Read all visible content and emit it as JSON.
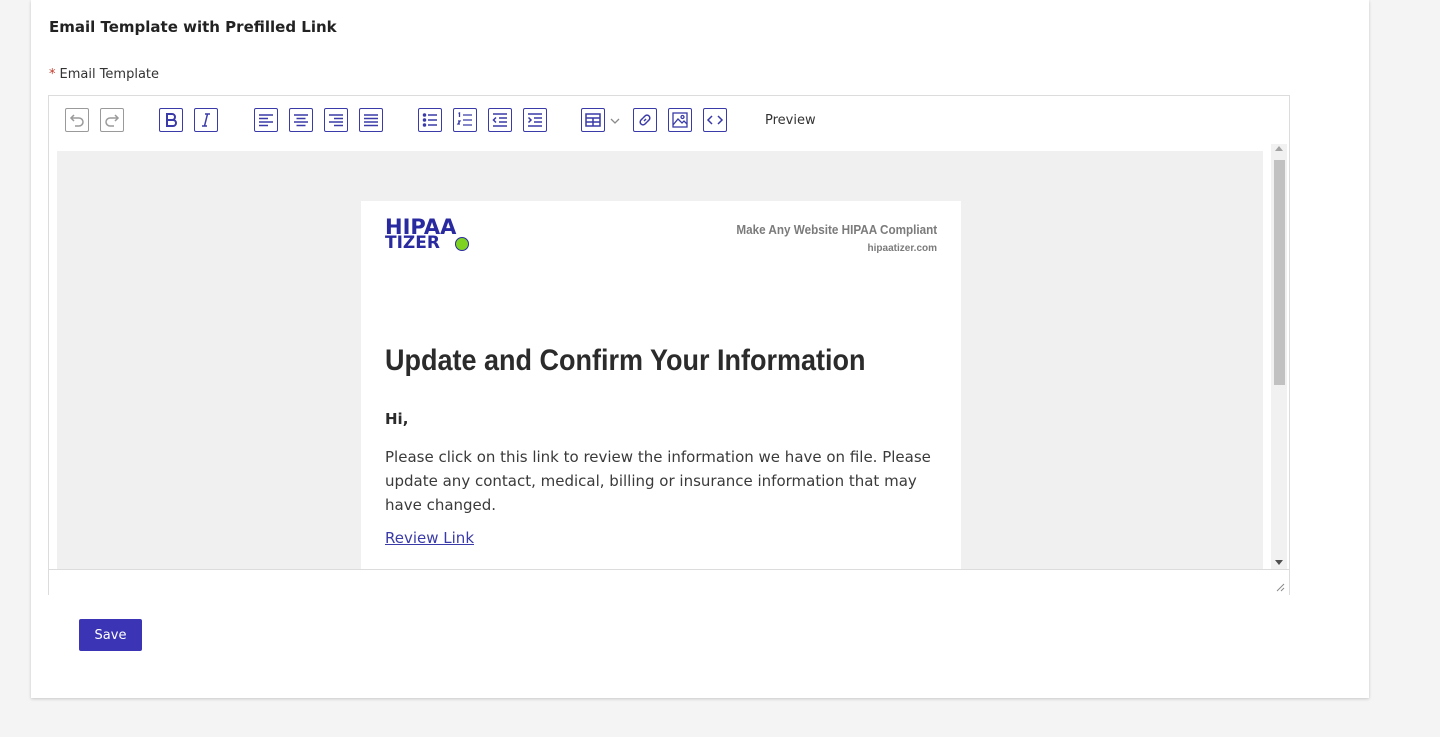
{
  "section": {
    "title": "Email Template with Prefilled Link"
  },
  "field": {
    "required_mark": "*",
    "label": "Email Template"
  },
  "toolbar": {
    "preview_label": "Preview",
    "buttons": [
      "undo-icon",
      "redo-icon",
      "bold-icon",
      "italic-icon",
      "align-left-icon",
      "align-center-icon",
      "align-right-icon",
      "align-justify-icon",
      "bullet-list-icon",
      "numbered-list-icon",
      "outdent-icon",
      "indent-icon",
      "table-icon",
      "link-icon",
      "image-icon",
      "code-icon"
    ],
    "accent_color": "#3a3aa8"
  },
  "email": {
    "logo_line1": "HIPAA",
    "logo_line2": "TIZER",
    "tagline": "Make Any Website HIPAA Compliant",
    "site": "hipaatizer.com",
    "heading": "Update and Confirm Your Information",
    "greeting": "Hi,",
    "body": "Please click on this link to review the information we have on file. Please update any contact, medical, billing or insurance information that may have changed.",
    "link_text": "Review Link"
  },
  "actions": {
    "save_label": "Save",
    "save_color": "#3b35b5"
  }
}
